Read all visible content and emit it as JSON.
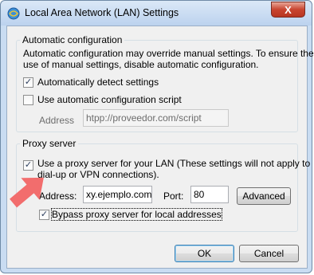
{
  "window": {
    "title": "Local Area Network (LAN) Settings",
    "close_glyph": "X"
  },
  "auto_config": {
    "legend": "Automatic configuration",
    "description_line1": "Automatic configuration may override manual settings.  To ensure the",
    "description_line2": "use of manual settings, disable automatic configuration.",
    "auto_detect": {
      "label": "Automatically detect settings",
      "checked": true
    },
    "use_script": {
      "label": "Use automatic configuration script",
      "checked": false
    },
    "address_label": "Address",
    "address_value": "htpp://proveedor.com/script"
  },
  "proxy": {
    "legend": "Proxy server",
    "use_proxy": {
      "label_line1": "Use a proxy server for your LAN (These settings will not apply to",
      "label_line2": "dial-up or VPN connections).",
      "checked": true
    },
    "address_label": "Address:",
    "address_value": "xy.ejemplo.com",
    "port_label": "Port:",
    "port_value": "80",
    "advanced_label": "Advanced",
    "bypass": {
      "label": "Bypass proxy server for local addresses",
      "checked": true
    }
  },
  "buttons": {
    "ok": "OK",
    "cancel": "Cancel"
  },
  "colors": {
    "arrow": "#f26d6d",
    "title_bar": "#c9dcf2",
    "close": "#c8442f"
  }
}
